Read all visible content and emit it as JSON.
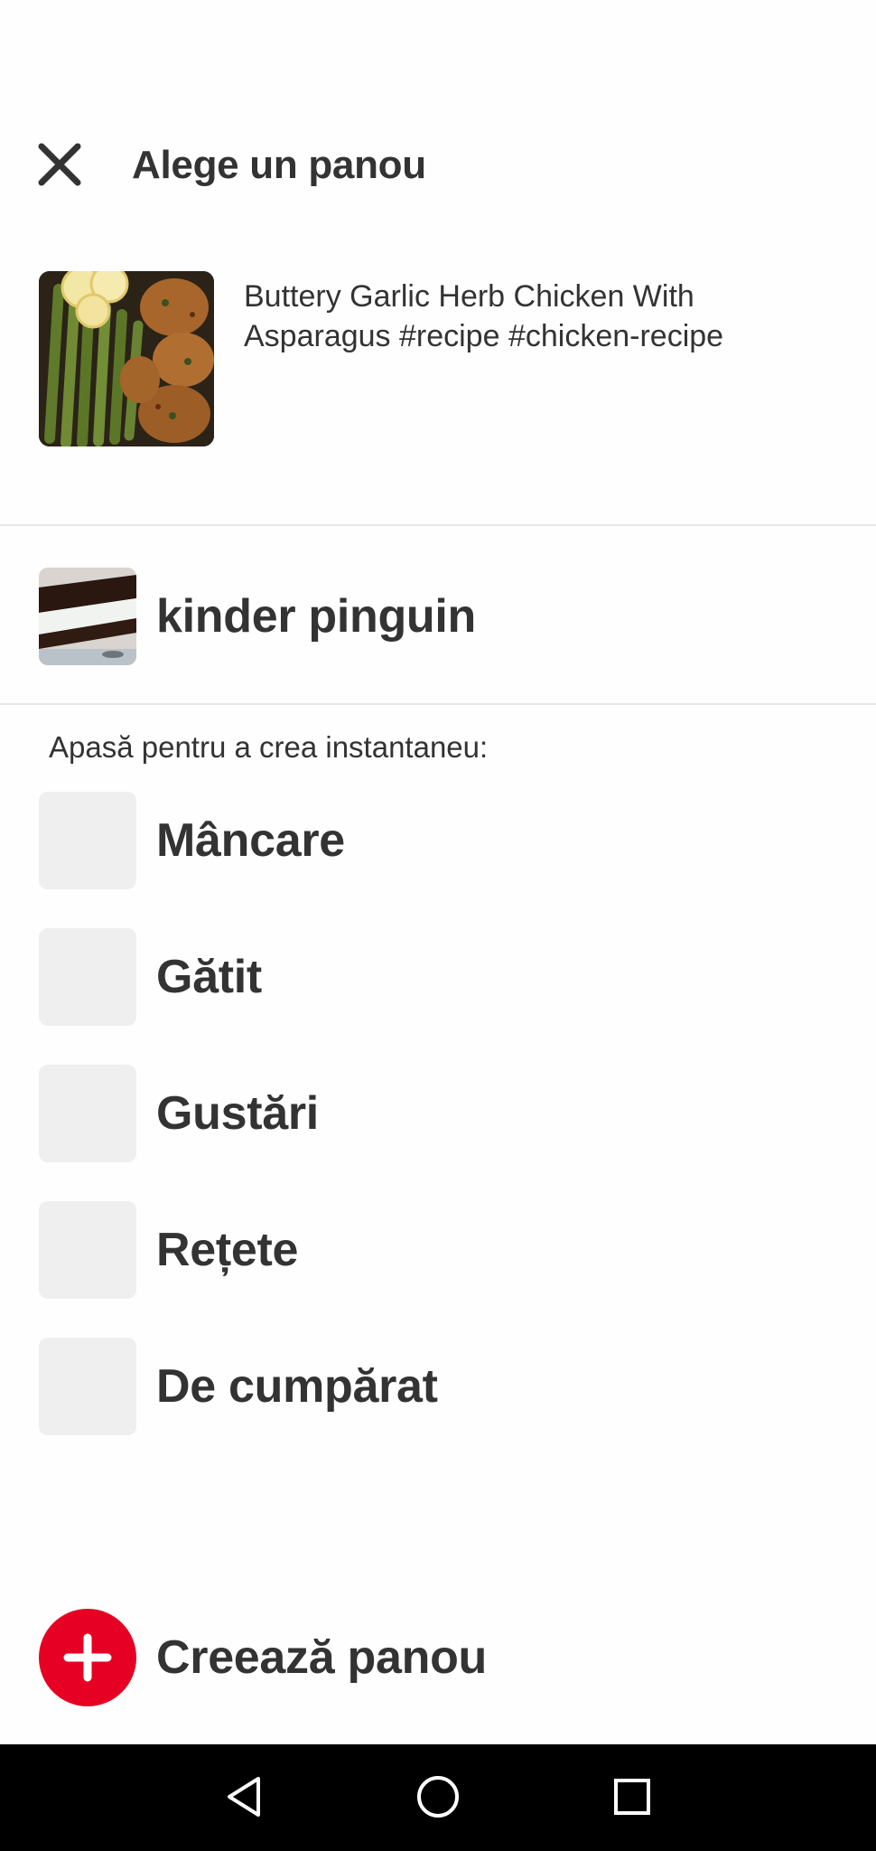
{
  "header": {
    "title": "Alege un panou",
    "close_icon": "close-icon"
  },
  "pin": {
    "description": "Buttery Garlic Herb Chicken With Asparagus #recipe #chicken-recipe",
    "thumbnail": "chicken-asparagus-photo"
  },
  "recent_board": {
    "name": "kinder pinguin",
    "thumbnail": "kinder-pinguin-photo"
  },
  "suggestions": {
    "label": "Apasă pentru a crea instantaneu:",
    "items": [
      {
        "label": "Mâncare"
      },
      {
        "label": "Gătit"
      },
      {
        "label": "Gustări"
      },
      {
        "label": "Rețete"
      },
      {
        "label": "De cumpărat"
      }
    ]
  },
  "create": {
    "label": "Creează panou",
    "icon": "plus-icon",
    "accent_color": "#e60023"
  },
  "navbar": {
    "back_icon": "back-triangle-icon",
    "home_icon": "home-circle-icon",
    "recents_icon": "recents-square-icon"
  }
}
